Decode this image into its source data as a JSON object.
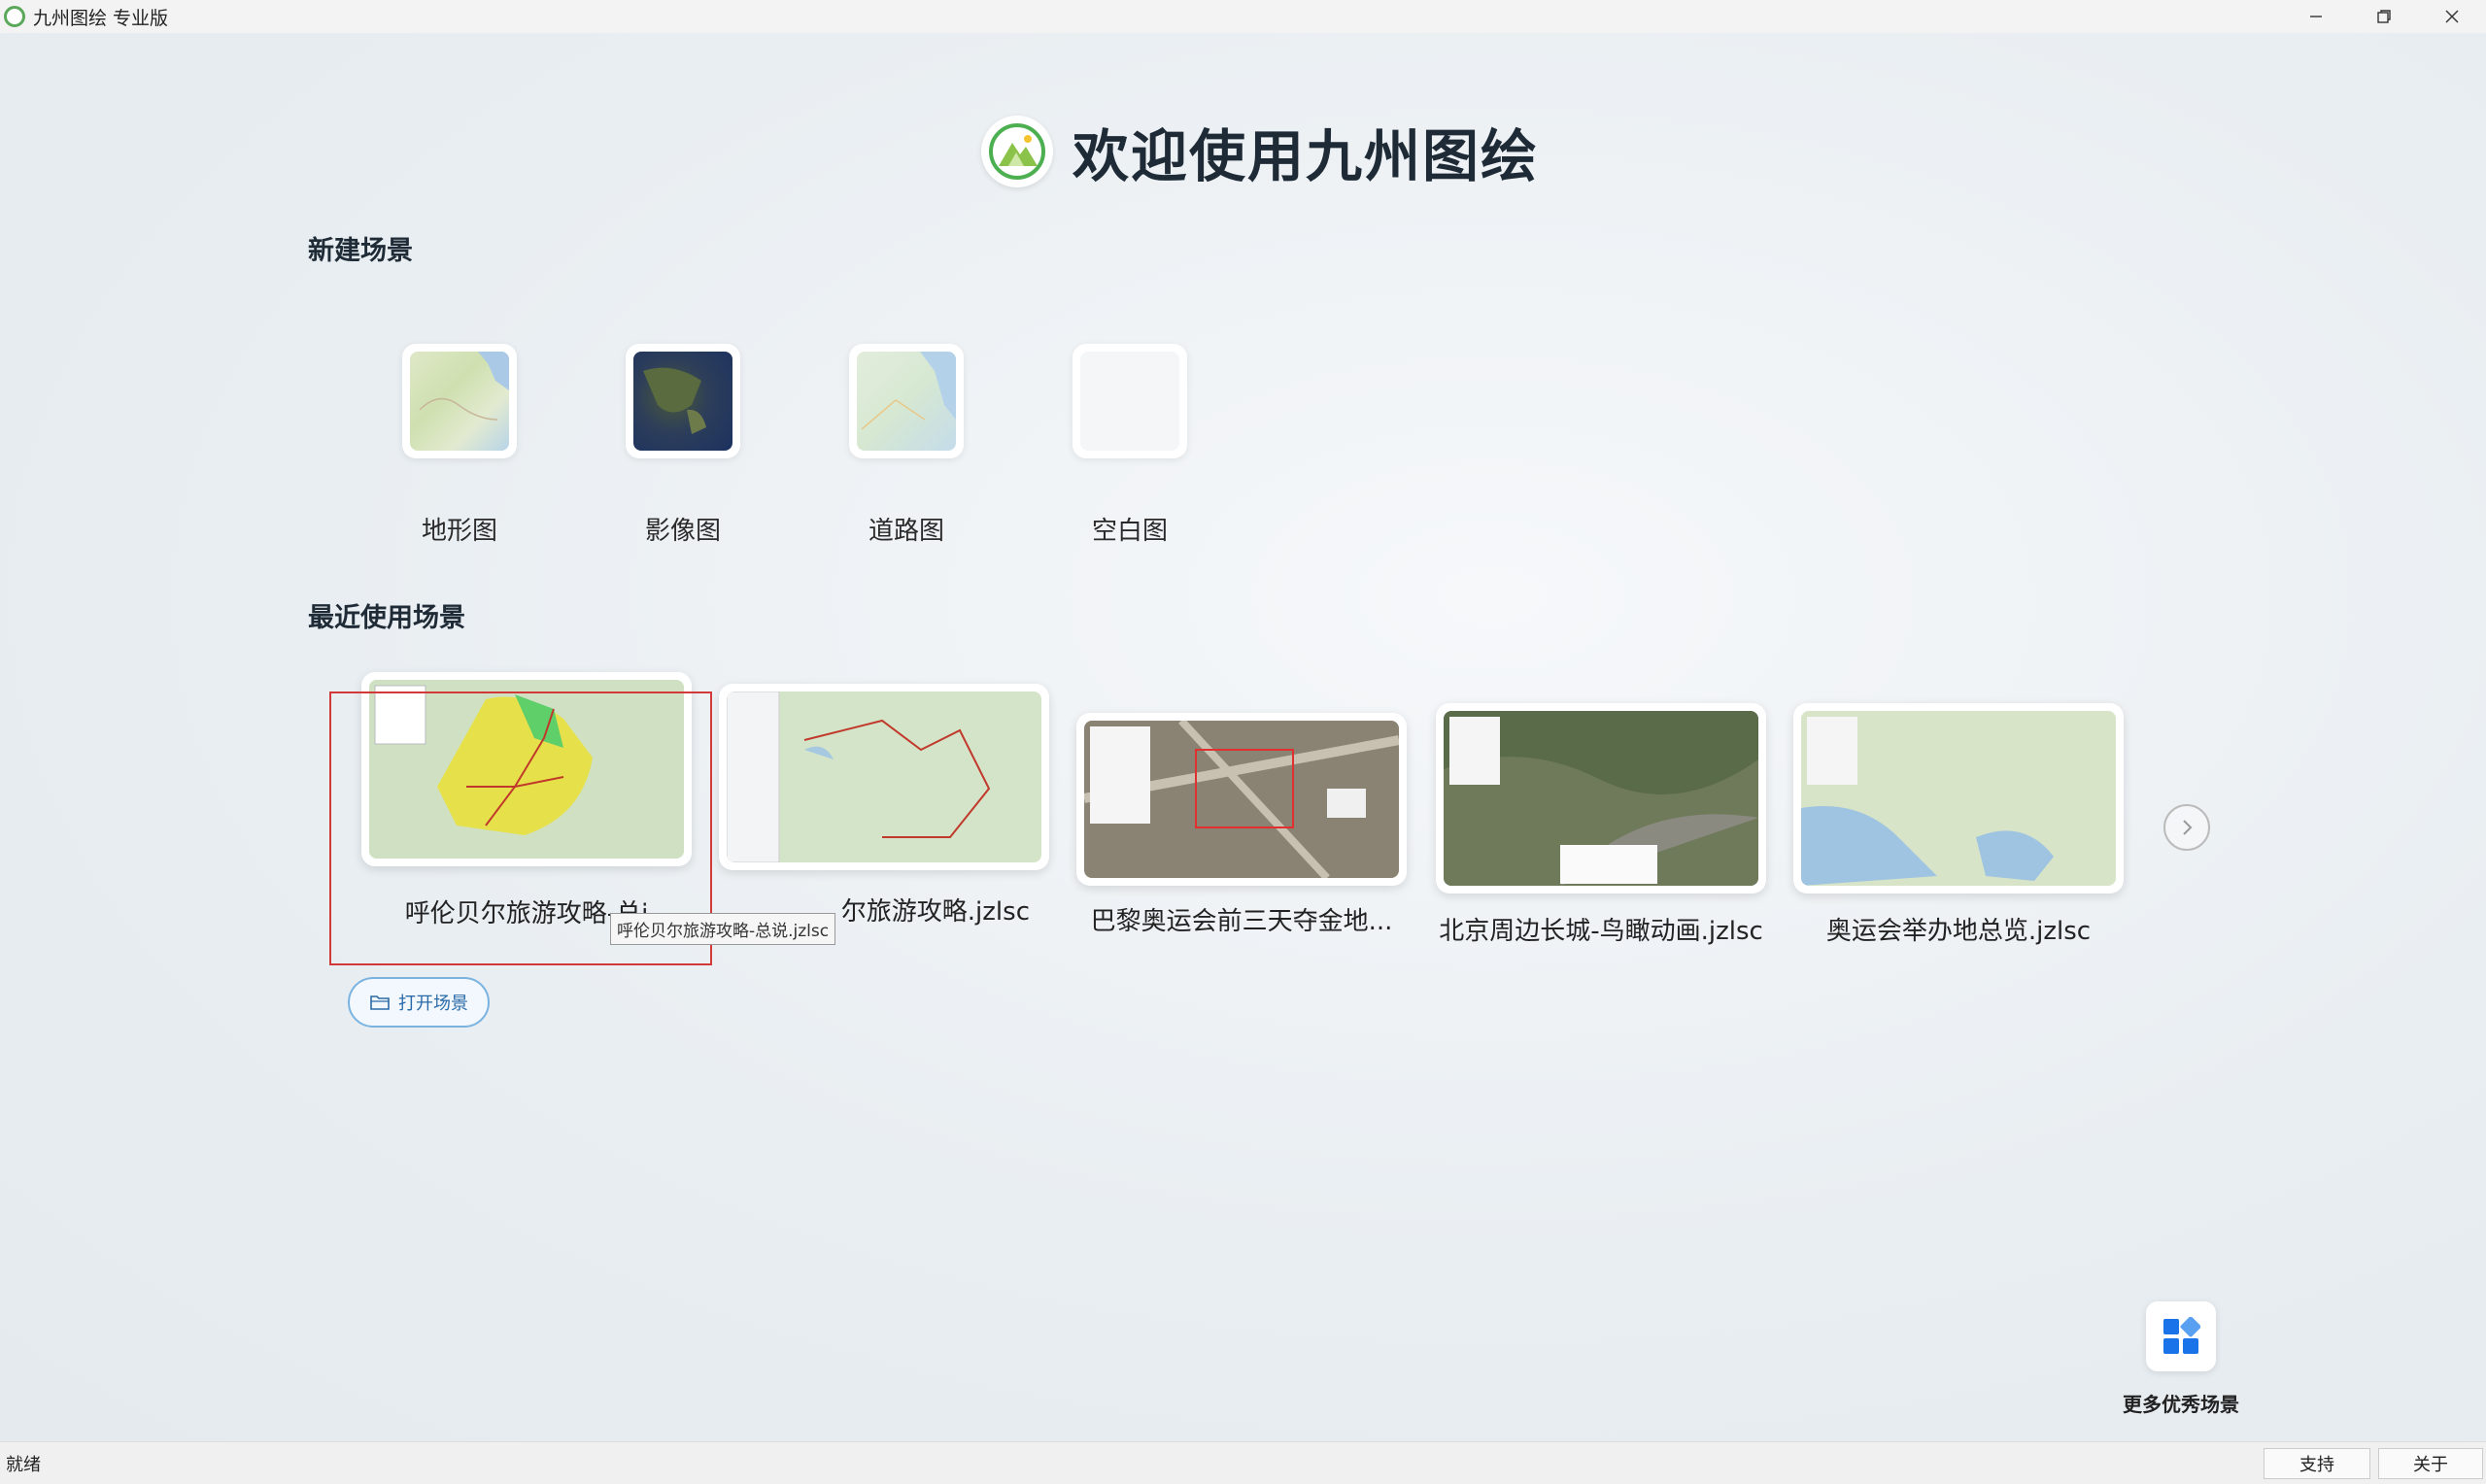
{
  "window": {
    "title": "九州图绘 专业版",
    "icon": "app-logo-icon"
  },
  "header": {
    "title": "欢迎使用九州图绘"
  },
  "new_scene": {
    "section_title": "新建场景",
    "items": [
      {
        "label": "地形图",
        "icon": "terrain-map-icon"
      },
      {
        "label": "影像图",
        "icon": "satellite-map-icon"
      },
      {
        "label": "道路图",
        "icon": "road-map-icon"
      },
      {
        "label": "空白图",
        "icon": "blank-map-icon"
      }
    ]
  },
  "recent_scenes": {
    "section_title": "最近使用场景",
    "items": [
      {
        "label": "呼伦贝尔旅游攻略-总说.jzlsc",
        "display": "呼伦贝尔旅游攻略-总i"
      },
      {
        "label": "呼伦贝尔旅游攻略.jzlsc",
        "display": "尔旅游攻略.jzlsc"
      },
      {
        "label": "巴黎奥运会前三天夺金地...",
        "display": "巴黎奥运会前三天夺金地..."
      },
      {
        "label": "北京周边长城-鸟瞰动画.jzlsc",
        "display": "北京周边长城-鸟瞰动画.jzlsc"
      },
      {
        "label": "奥运会举办地总览.jzlsc",
        "display": "奥运会举办地总览.jzlsc"
      }
    ],
    "tooltip": "呼伦贝尔旅游攻略-总说.jzlsc",
    "open_button": "打开场景"
  },
  "more": {
    "label": "更多优秀场景"
  },
  "status": {
    "text": "就绪",
    "support_button": "支持",
    "about_button": "关于"
  },
  "colors": {
    "highlight": "#d23a3a",
    "accent": "#2b6aa8",
    "more_icon": "#1a73e8"
  }
}
